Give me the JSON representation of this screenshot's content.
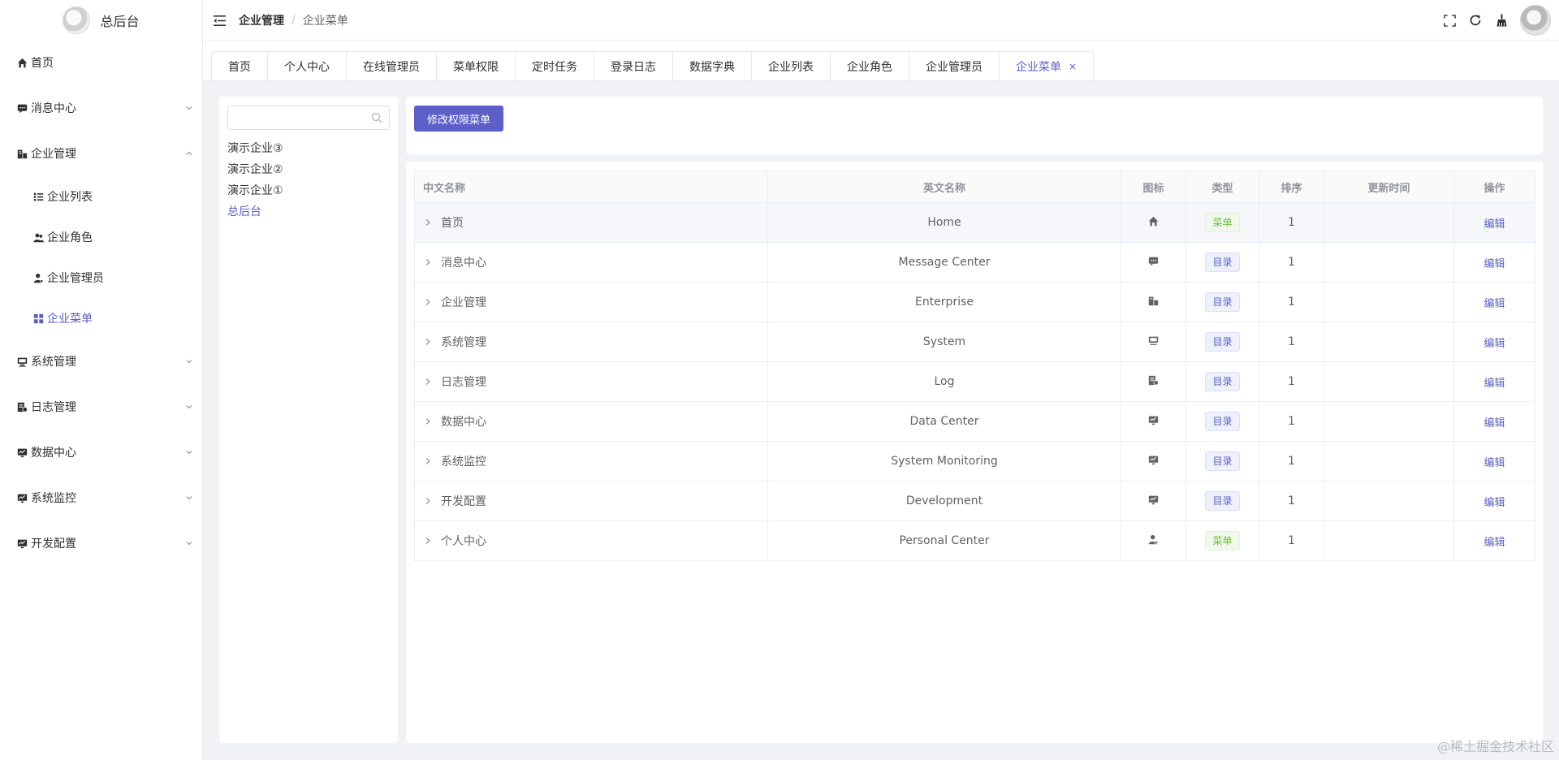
{
  "app": {
    "title": "总后台"
  },
  "sidebar": {
    "items": [
      {
        "label": "首页",
        "icon": "home-icon"
      },
      {
        "label": "消息中心",
        "icon": "message-icon"
      },
      {
        "label": "企业管理",
        "icon": "enterprise-icon"
      },
      {
        "label": "企业列表",
        "icon": "list-icon"
      },
      {
        "label": "企业角色",
        "icon": "role-icon"
      },
      {
        "label": "企业管理员",
        "icon": "admin-icon"
      },
      {
        "label": "企业菜单",
        "icon": "grid-icon"
      },
      {
        "label": "系统管理",
        "icon": "system-icon"
      },
      {
        "label": "日志管理",
        "icon": "log-icon"
      },
      {
        "label": "数据中心",
        "icon": "monitor-icon"
      },
      {
        "label": "系统监控",
        "icon": "monitor-icon"
      },
      {
        "label": "开发配置",
        "icon": "monitor-icon"
      }
    ]
  },
  "header": {
    "breadcrumb": {
      "parent": "企业管理",
      "separator": "/",
      "current": "企业菜单"
    },
    "tools": [
      "fullscreen-icon",
      "refresh-icon",
      "broom-icon",
      "avatar"
    ]
  },
  "tabs": {
    "items": [
      "首页",
      "个人中心",
      "在线管理员",
      "菜单权限",
      "定时任务",
      "登录日志",
      "数据字典",
      "企业列表",
      "企业角色",
      "企业管理员",
      "企业菜单"
    ],
    "close_glyph": "×"
  },
  "tree": {
    "search": {
      "value": "",
      "placeholder": ""
    },
    "nodes": [
      "演示企业③",
      "演示企业②",
      "演示企业①",
      "总后台"
    ]
  },
  "toolbar": {
    "edit_button": "修改权限菜单"
  },
  "table": {
    "headers": {
      "cn_name": "中文名称",
      "en_name": "英文名称",
      "icon": "图标",
      "type": "类型",
      "sort": "排序",
      "updated": "更新时间",
      "action": "操作"
    },
    "rows": [
      {
        "cn": "首页",
        "en": "Home",
        "icon": "home-icon",
        "type": "菜单",
        "sort": "1",
        "updated": "",
        "action": "编辑"
      },
      {
        "cn": "消息中心",
        "en": "Message Center",
        "icon": "message-icon",
        "type": "目录",
        "sort": "1",
        "updated": "",
        "action": "编辑"
      },
      {
        "cn": "企业管理",
        "en": "Enterprise",
        "icon": "enterprise-icon",
        "type": "目录",
        "sort": "1",
        "updated": "",
        "action": "编辑"
      },
      {
        "cn": "系统管理",
        "en": "System",
        "icon": "system-icon",
        "type": "目录",
        "sort": "1",
        "updated": "",
        "action": "编辑"
      },
      {
        "cn": "日志管理",
        "en": "Log",
        "icon": "log-icon",
        "type": "目录",
        "sort": "1",
        "updated": "",
        "action": "编辑"
      },
      {
        "cn": "数据中心",
        "en": "Data Center",
        "icon": "monitor-icon",
        "type": "目录",
        "sort": "1",
        "updated": "",
        "action": "编辑"
      },
      {
        "cn": "系统监控",
        "en": "System Monitoring",
        "icon": "monitor-icon",
        "type": "目录",
        "sort": "1",
        "updated": "",
        "action": "编辑"
      },
      {
        "cn": "开发配置",
        "en": "Development",
        "icon": "monitor-icon",
        "type": "目录",
        "sort": "1",
        "updated": "",
        "action": "编辑"
      },
      {
        "cn": "个人中心",
        "en": "Personal Center",
        "icon": "user-icon",
        "type": "菜单",
        "sort": "1",
        "updated": "",
        "action": "编辑"
      }
    ]
  },
  "watermark": "@稀土掘金技术社区",
  "colors": {
    "accent": "#5b5fc7",
    "menu_tag": "#67c23a",
    "background": "#f0f2f5"
  }
}
